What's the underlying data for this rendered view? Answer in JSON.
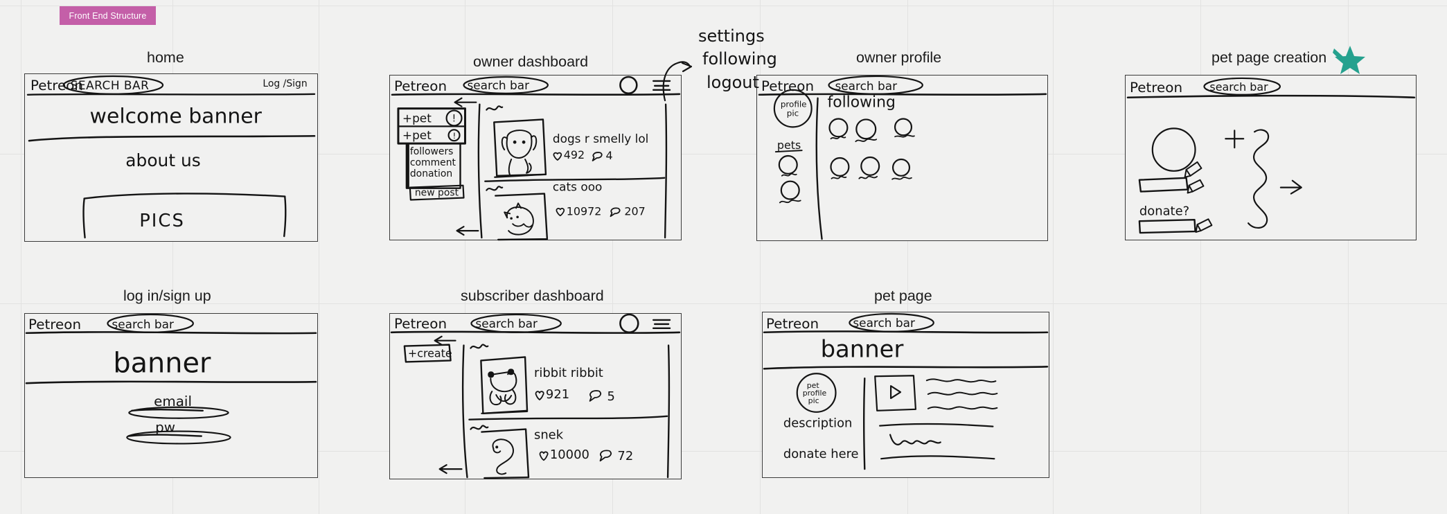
{
  "page_tag": {
    "label": "Front End Structure",
    "color": "#c45fa8"
  },
  "accent": {
    "star": "#25a18e",
    "ink": "#141414",
    "grid": "#e2e2e1",
    "background": "#f1f1f0"
  },
  "annotations": {
    "menu_items": [
      "settings",
      "following",
      "logout"
    ],
    "star_marker": "star-icon"
  },
  "frames": [
    {
      "id": "home",
      "title": "home",
      "nav": {
        "brand": "Petreon",
        "search": "SEARCH BAR",
        "right_link": "Log /Sign"
      },
      "body": {
        "banner": "welcome banner",
        "about": "about us",
        "pics": "PICS"
      }
    },
    {
      "id": "owner-dashboard",
      "title": "owner dashboard",
      "nav": {
        "brand": "Petreon",
        "search": "search bar",
        "avatar": "avatar-circle",
        "menu": "hamburger-icon"
      },
      "sidebar": {
        "buttons": [
          "+pet",
          "+pet"
        ],
        "badges": [
          "!",
          "!"
        ],
        "menu": [
          "followers",
          "comment",
          "donation"
        ],
        "new_post": "new post"
      },
      "posts": [
        {
          "caption": "dogs r smelly lol",
          "likes": "492",
          "comments": "4",
          "thumb": "dog-sketch"
        },
        {
          "caption": "cats ooo",
          "likes": "10972",
          "comments": "207",
          "thumb": "cat-sketch"
        }
      ]
    },
    {
      "id": "owner-profile",
      "title": "owner profile",
      "nav": {
        "brand": "Petreon",
        "search": "search bar"
      },
      "sidebar": {
        "profile_pic": "profile pic",
        "pets_label": "pets",
        "pet_count": 2
      },
      "main": {
        "heading": "following",
        "avatar_rows": [
          3,
          3
        ]
      }
    },
    {
      "id": "pet-page-creation",
      "title": "pet page creation",
      "nav": {
        "brand": "Petreon",
        "search": "search bar"
      },
      "body": {
        "avatar_placeholder": "circle-upload",
        "name_field": "name-input",
        "donate_label": "donate?",
        "donate_field": "donate-input",
        "plus": "+",
        "arrow": "arrow-right-icon"
      }
    },
    {
      "id": "log-in-sign-up",
      "title": "log in/sign up",
      "nav": {
        "brand": "Petreon",
        "search": "search bar"
      },
      "body": {
        "banner": "banner",
        "fields": [
          "email",
          "pw"
        ]
      }
    },
    {
      "id": "subscriber-dashboard",
      "title": "subscriber dashboard",
      "nav": {
        "brand": "Petreon",
        "search": "search bar",
        "avatar": "avatar-circle",
        "menu": "hamburger-icon"
      },
      "sidebar": {
        "create_button": "+create"
      },
      "posts": [
        {
          "caption": "ribbit ribbit",
          "likes": "921",
          "comments": "5",
          "thumb": "frog-sketch"
        },
        {
          "caption": "snek",
          "likes": "10000",
          "comments": "72",
          "thumb": "snake-sketch"
        }
      ]
    },
    {
      "id": "pet-page",
      "title": "pet page",
      "nav": {
        "brand": "Petreon",
        "search": "search bar"
      },
      "body": {
        "banner": "banner",
        "profile_pic": "pet profile pic",
        "description_label": "description",
        "donate_label": "donate here",
        "video_thumb": "play-icon"
      }
    }
  ]
}
